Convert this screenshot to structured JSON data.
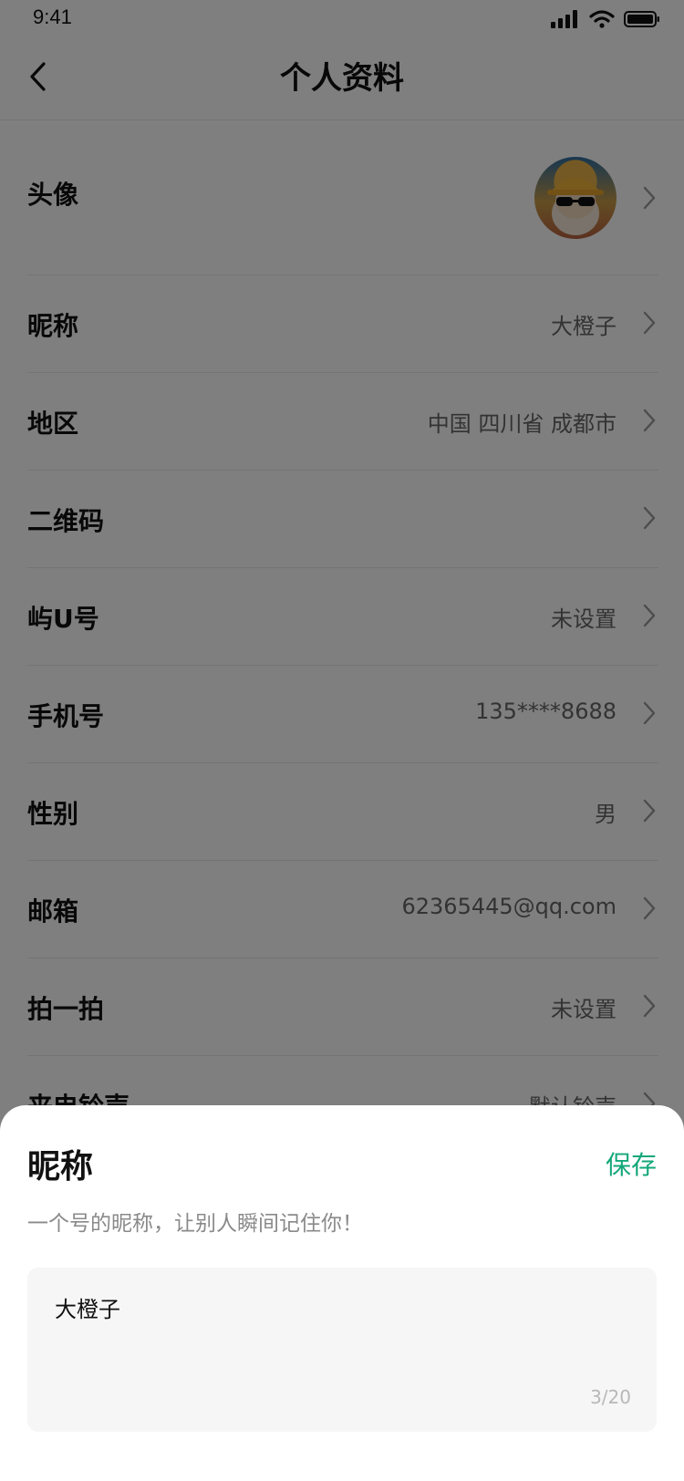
{
  "status_bar": {
    "time": "9:41"
  },
  "nav": {
    "title": "个人资料"
  },
  "rows": [
    {
      "label": "头像",
      "value": "",
      "type": "avatar"
    },
    {
      "label": "昵称",
      "value": "大橙子"
    },
    {
      "label": "地区",
      "value": "中国 四川省 成都市"
    },
    {
      "label": "二维码",
      "value": ""
    },
    {
      "label": "屿U号",
      "value": "未设置"
    },
    {
      "label": "手机号",
      "value": "135****8688"
    },
    {
      "label": "性别",
      "value": "男"
    },
    {
      "label": "邮箱",
      "value": "62365445@qq.com"
    },
    {
      "label": "拍一拍",
      "value": "未设置"
    },
    {
      "label": "来电铃声",
      "value": "默认铃声"
    }
  ],
  "sheet": {
    "title": "昵称",
    "save_label": "保存",
    "description": "一个号的昵称，让别人瞬间记住你！",
    "input_value": "大橙子",
    "char_count": "3/20"
  },
  "colors": {
    "accent": "#13a77a",
    "overlay": "rgba(0,0,0,0.5)"
  }
}
